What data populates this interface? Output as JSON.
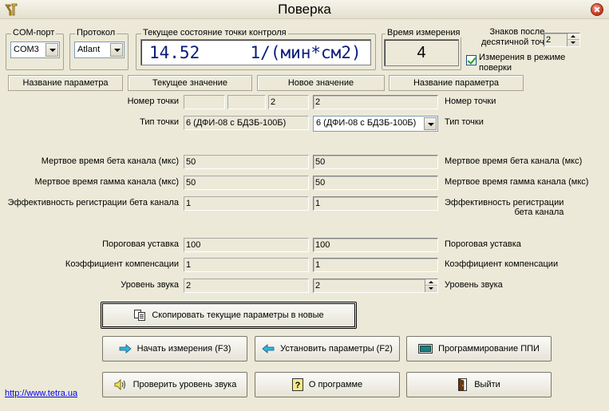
{
  "window": {
    "title": "Поверка"
  },
  "com_port": {
    "legend": "COM-порт",
    "value": "COM3"
  },
  "protocol": {
    "legend": "Протокол",
    "value": "Atlant"
  },
  "current_state": {
    "legend": "Текущее состояние точки контроля",
    "value": "14.52",
    "unit": "1/(мин*см2)"
  },
  "measure_time": {
    "legend": "Время измерения",
    "value": "4"
  },
  "decimals": {
    "label_line1": "Знаков после",
    "label_line2": "десятичной точки",
    "value": "2"
  },
  "check_mode": {
    "label_line1": "Измерения в режиме",
    "label_line2": "поверки",
    "checked": true
  },
  "headers": [
    "Название параметра",
    "Текущее значение",
    "Новое значение",
    "Название параметра"
  ],
  "point_number": {
    "label": "Номер точки",
    "current": "2",
    "new": "2"
  },
  "point_type": {
    "label": "Тип точки",
    "current": "6 (ДФИ-08 с БДЗБ-100Б)",
    "new": "6 (ДФИ-08 с БДЗБ-100Б)"
  },
  "dead_beta": {
    "label": "Мертвое время бета канала (мкс)",
    "current": "50",
    "new": "50"
  },
  "dead_gamma": {
    "label": "Мертвое время гамма канала (мкс)",
    "current": "50",
    "new": "50"
  },
  "efficiency": {
    "label": "Эффективность регистрации бета канала",
    "label_right_line1": "Эффективность регистрации",
    "label_right_line2": "бета канала",
    "current": "1",
    "new": "1"
  },
  "threshold": {
    "label": "Пороговая уставка",
    "current": "100",
    "new": "100"
  },
  "compensation": {
    "label": "Коэффициент компенсации",
    "current": "1",
    "new": "1"
  },
  "sound_level": {
    "label": "Уровень звука",
    "current": "2",
    "new": "2"
  },
  "buttons": {
    "copy": "Скопировать текущие параметры в новые",
    "start": "Начать измерения (F3)",
    "set_params": "Установить параметры (F2)",
    "program_ppi": "Программирование ППИ",
    "check_sound": "Проверить уровень звука",
    "about": "О программе",
    "exit": "Выйти"
  },
  "link": {
    "text": "http://www.tetra.ua"
  },
  "colors": {
    "link": "#0000ee",
    "display_text": "#0a1c7a",
    "window_bg": "#ece9d8"
  }
}
